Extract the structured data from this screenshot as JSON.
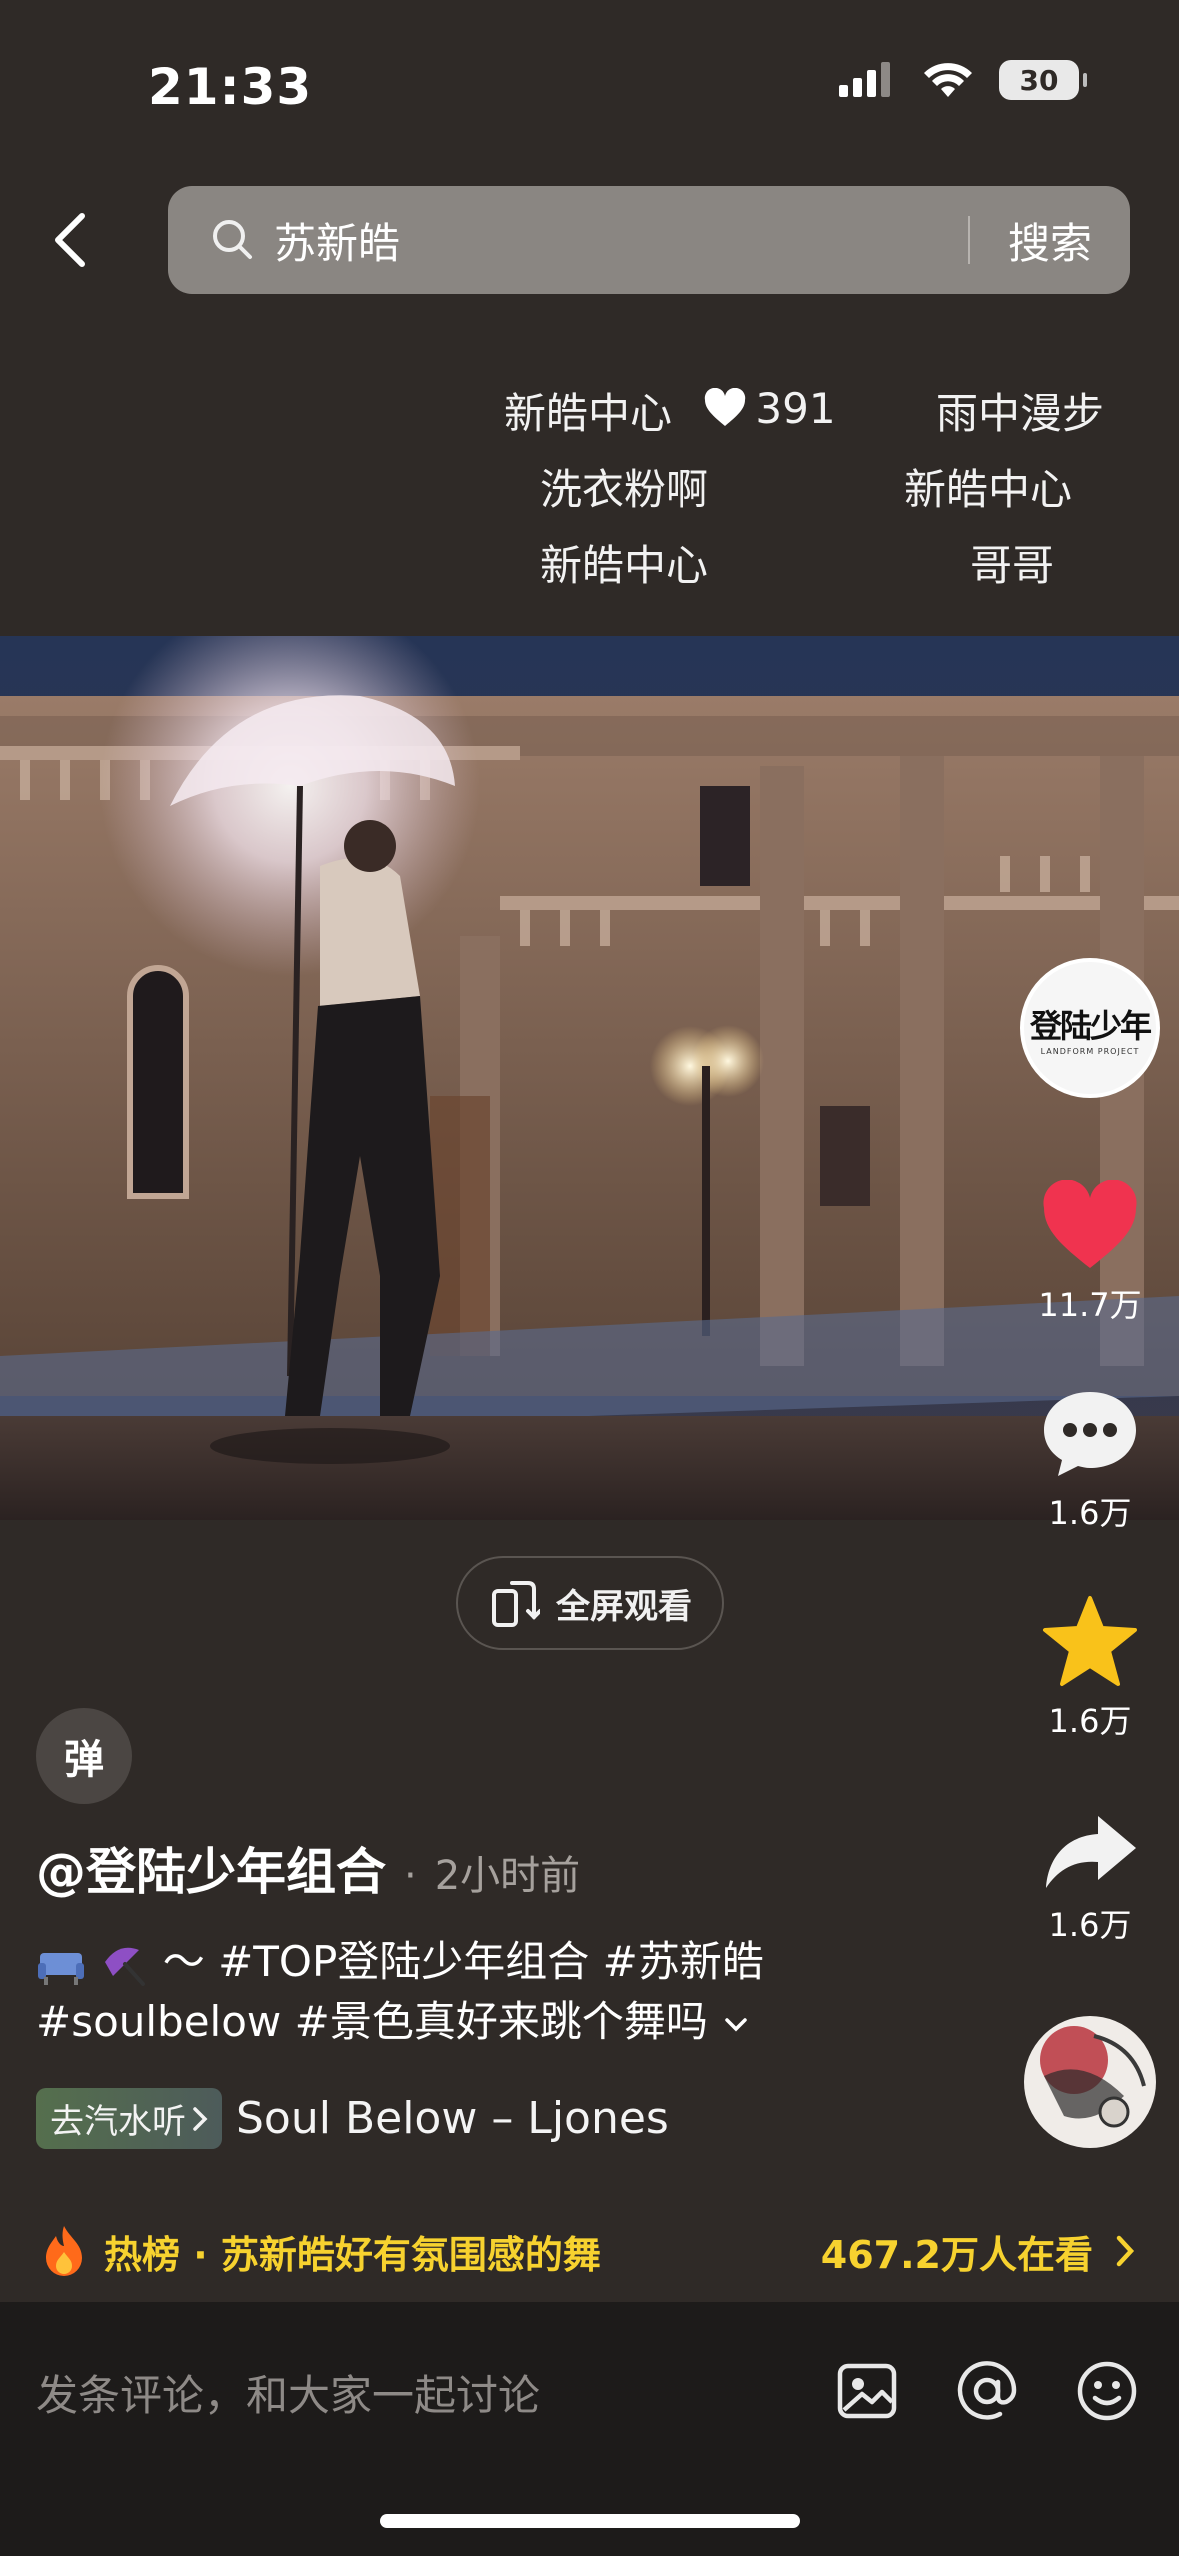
{
  "status_bar": {
    "time": "21:33",
    "battery": "30"
  },
  "search": {
    "query": "苏新皓",
    "button": "搜索"
  },
  "danmaku": {
    "line1_left": "新皓中心",
    "line1_likes": "391",
    "line1_right": "雨中漫步",
    "line2_left": "洗衣粉啊",
    "line2_right": "新皓中心",
    "line3_left": "新皓中心",
    "line3_right": "哥哥"
  },
  "video": {
    "fullscreen_label": "全屏观看"
  },
  "side_rail": {
    "avatar_brand": "登陆少年",
    "avatar_sub": "LANDFORM PROJECT",
    "likes": "11.7万",
    "comments": "1.6万",
    "favorites": "1.6万",
    "shares": "1.6万"
  },
  "danmu_toggle": "弹",
  "post": {
    "author": "@登陆少年组合",
    "separator": "·",
    "time": "2小时前",
    "desc_line1_text": "～ #TOP登陆少年组合 #苏新皓",
    "desc_line2_text": "#soulbelow #景色真好来跳个舞吗",
    "music_tag": "去汽水听",
    "music_title": "Soul Below – Ljones"
  },
  "hot_rank": {
    "text": "热榜 · 苏新皓好有氛围感的舞",
    "viewers": "467.2万人在看"
  },
  "comment_bar": {
    "placeholder": "发条评论，和大家一起讨论"
  },
  "colors": {
    "like_red": "#f0334f",
    "star_yellow": "#f9c21a",
    "rank_yellow": "#f7d22f",
    "page_bg": "#2f2a27"
  }
}
